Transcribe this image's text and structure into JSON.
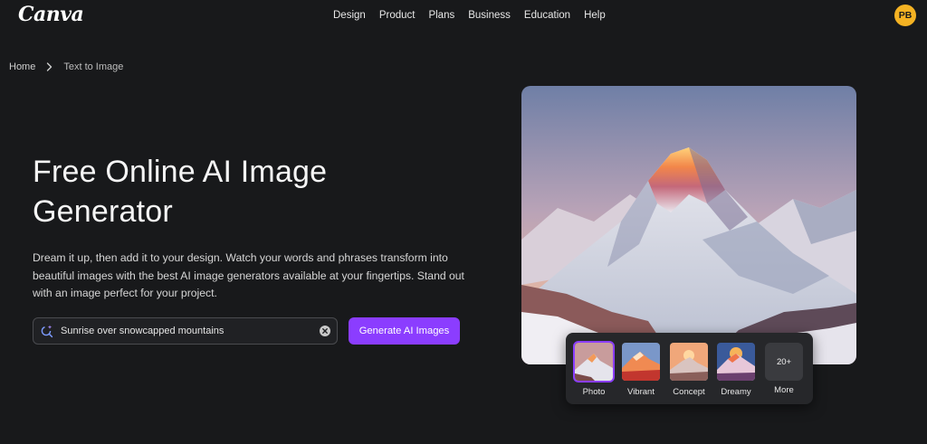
{
  "header": {
    "logo": "Canva",
    "nav": [
      "Design",
      "Product",
      "Plans",
      "Business",
      "Education",
      "Help"
    ],
    "avatar_initials": "PB"
  },
  "breadcrumb": {
    "home": "Home",
    "current": "Text to Image"
  },
  "hero": {
    "title": "Free Online AI Image Generator",
    "description": "Dream it up, then add it to your design. Watch your words and phrases transform into beautiful images with the best AI image generators available at your fingertips. Stand out with an image perfect for your project."
  },
  "search": {
    "value": "Sunrise over snowcapped mountains"
  },
  "generate_button": "Generate AI Images",
  "styles": {
    "items": [
      "Photo",
      "Vibrant",
      "Concept",
      "Dreamy"
    ],
    "selected": "Photo",
    "more_count": "20+",
    "more_label": "More"
  },
  "colors": {
    "accent": "#8b3dff",
    "avatar": "#f4b223",
    "background": "#18191b"
  }
}
